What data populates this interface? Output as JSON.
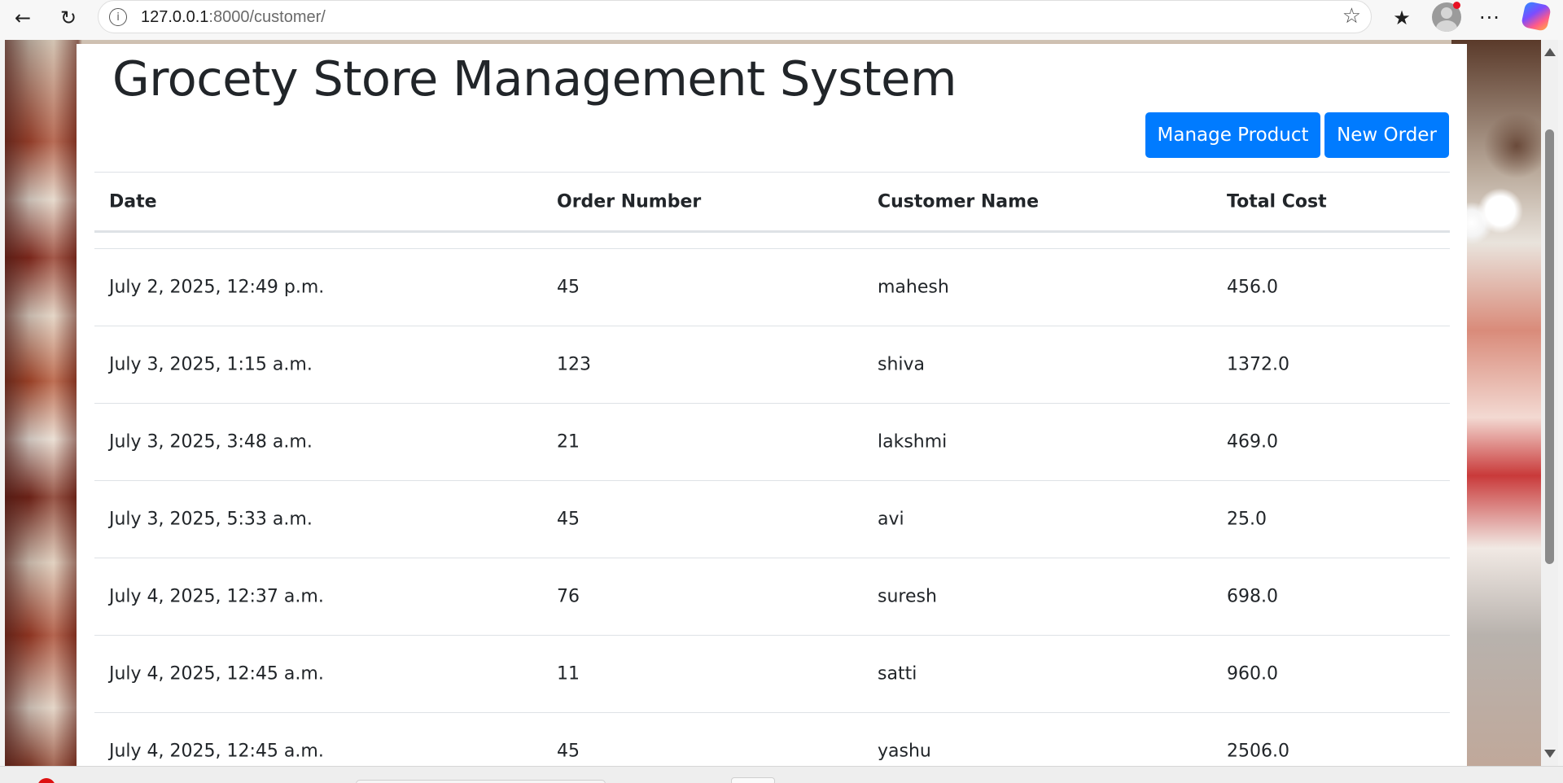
{
  "browser": {
    "url_host": "127.0.0.1",
    "url_rest": ":8000/customer/",
    "icons": {
      "back": "back-arrow-icon",
      "reload": "reload-icon",
      "info": "site-info-icon",
      "star": "favorite-star-icon",
      "favorites": "favorites-icon",
      "profile": "profile-icon",
      "more": "more-icon",
      "copilot": "copilot-icon"
    }
  },
  "page": {
    "title": "Grocety Store Management System",
    "buttons": {
      "manage_product": "Manage Product",
      "new_order": "New Order"
    },
    "accent_color": "#007bff"
  },
  "table": {
    "headers": [
      "Date",
      "Order Number",
      "Customer Name",
      "Total Cost"
    ],
    "rows": [
      [
        "July 2, 2025, 12:49 p.m.",
        "45",
        "mahesh",
        "456.0"
      ],
      [
        "July 3, 2025, 1:15 a.m.",
        "123",
        "shiva",
        "1372.0"
      ],
      [
        "July 3, 2025, 3:48 a.m.",
        "21",
        "lakshmi",
        "469.0"
      ],
      [
        "July 3, 2025, 5:33 a.m.",
        "45",
        "avi",
        "25.0"
      ],
      [
        "July 4, 2025, 12:37 a.m.",
        "76",
        "suresh",
        "698.0"
      ],
      [
        "July 4, 2025, 12:45 a.m.",
        "11",
        "satti",
        "960.0"
      ],
      [
        "July 4, 2025, 12:45 a.m.",
        "45",
        "yashu",
        "2506.0"
      ]
    ]
  }
}
